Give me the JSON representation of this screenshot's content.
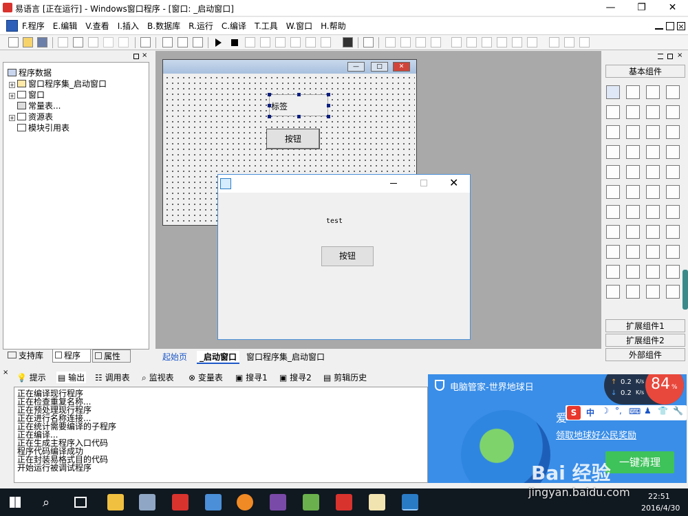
{
  "window": {
    "title": "易语言 [正在运行] - Windows窗口程序 - [窗口: _启动窗口]",
    "min": "—",
    "max": "❐",
    "close": "✕"
  },
  "menu": [
    "F.程序",
    "E.编辑",
    "V.查看",
    "I.插入",
    "B.数据库",
    "R.运行",
    "C.编译",
    "T.工具",
    "W.窗口",
    "H.帮助"
  ],
  "tree": {
    "root": "程序数据",
    "items": [
      "窗口程序集_启动窗口",
      "窗口",
      "常量表...",
      "资源表",
      "模块引用表"
    ]
  },
  "left_tabs": [
    "支持库",
    "程序",
    "属性"
  ],
  "designer": {
    "label": "标签",
    "button": "按钮"
  },
  "runwin": {
    "text": "test",
    "button": "按钮"
  },
  "right_panel": {
    "header": "基本组件",
    "ext1": "扩展组件1",
    "ext2": "扩展组件2",
    "ext3": "外部组件"
  },
  "doc_tabs": [
    "起始页",
    "_启动窗口",
    "窗口程序集_启动窗口"
  ],
  "out_tabs": [
    "提示",
    "输出",
    "调用表",
    "监视表",
    "变量表",
    "搜寻1",
    "搜寻2",
    "剪辑历史"
  ],
  "output": [
    "正在编译现行程序",
    "正在检查重复名称...",
    "正在预处理现行程序",
    "正在进行名称连接...",
    "正在统计需要编译的子程序",
    "正在编译...",
    "正在生成主程序入口代码",
    "程序代码编译成功",
    "正在封装易格式目的代码",
    "开始运行被调试程序"
  ],
  "popup": {
    "title": "电脑管家-世界地球日",
    "sogou": "中",
    "link": "领取地球好公民奖励",
    "button": "一键清理",
    "pct": "84",
    "up": "0.2",
    "down": "0.2",
    "unit": "K/s",
    "love": "爱"
  },
  "watermark": {
    "logo": "Bai 经验",
    "url": "jingyan.baidu.com"
  },
  "taskbar": {
    "time": "22:51",
    "date": "2016/4/30"
  }
}
